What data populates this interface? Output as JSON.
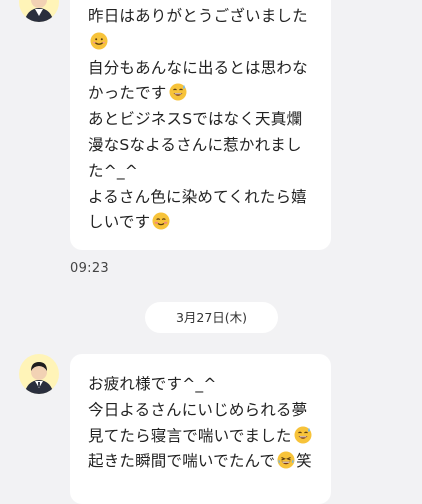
{
  "messages": [
    {
      "lines": [
        "昨日はありがとうございました",
        "",
        "自分もあんなに出るとは思わな",
        "かったです",
        "あとビジネスSではなく天真爛",
        "漫なSなよるさんに惹かれまし",
        "た^_^",
        "よるさん色に染めてくれたら嬉",
        "しいです"
      ],
      "emojis": [
        "smiling-face-emoji",
        "sweat-smile-emoji",
        "blushing-face-emoji"
      ],
      "time": "09:23"
    },
    {
      "lines": [
        "お疲れ様です^_^",
        "今日よるさんにいじめられる夢",
        "見てたら寝言で喘いでました",
        "起きた瞬間で喘いでたんで",
        "笑"
      ],
      "emojis": [
        "sweat-smile-emoji",
        "laughing-tears-emoji"
      ]
    }
  ],
  "date_separator": "3月27日(木)",
  "colors": {
    "background": "#f2f2f4",
    "bubble": "#ffffff",
    "avatar_bg": "#fff4b8",
    "emoji_yellow": "#f7c33a"
  }
}
